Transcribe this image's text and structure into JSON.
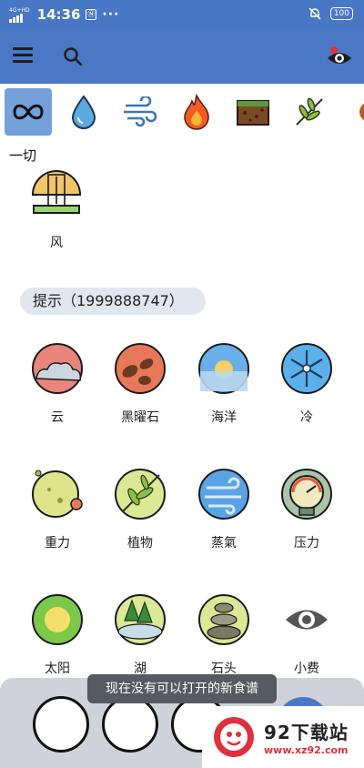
{
  "status_bar": {
    "network": "4G+HD",
    "time": "14:36",
    "hd_badge": "Ⓝ",
    "dots": "···",
    "battery": "100"
  },
  "app_bar": {
    "menu_icon": "hamburger-menu-icon",
    "search_icon": "search-icon",
    "eye_icon": "eye-notification-icon"
  },
  "tabs": [
    {
      "icon": "infinity-icon",
      "active": true
    },
    {
      "icon": "water-drop-icon",
      "active": false
    },
    {
      "icon": "wind-icon",
      "active": false
    },
    {
      "icon": "fire-icon",
      "active": false
    },
    {
      "icon": "earth-icon",
      "active": false
    },
    {
      "icon": "plant-icon",
      "active": false
    },
    {
      "icon": "brown-blob-icon",
      "active": false
    }
  ],
  "filter_label": "一切",
  "top_item": {
    "label": "风",
    "icon": "windmill-icon"
  },
  "hint": "提示（1999888747）",
  "items": [
    {
      "label": "云",
      "icon": "cloud-icon"
    },
    {
      "label": "黑曜石",
      "icon": "obsidian-icon"
    },
    {
      "label": "海洋",
      "icon": "ocean-icon"
    },
    {
      "label": "冷",
      "icon": "snowflake-icon"
    },
    {
      "label": "重力",
      "icon": "gravity-icon"
    },
    {
      "label": "植物",
      "icon": "plant-leaf-icon"
    },
    {
      "label": "蒸氣",
      "icon": "steam-icon"
    },
    {
      "label": "压力",
      "icon": "pressure-gauge-icon"
    },
    {
      "label": "太阳",
      "icon": "sun-icon"
    },
    {
      "label": "湖",
      "icon": "lake-icon"
    },
    {
      "label": "石头",
      "icon": "stone-icon"
    },
    {
      "label": "小费",
      "icon": "eye-tip-icon"
    }
  ],
  "toast": "现在没有可以打开的新食谱",
  "watermark": {
    "title": "92下载站",
    "url": "www.xz92.com"
  },
  "colors": {
    "primary": "#4a78c5",
    "tab_active": "#74a0dc",
    "hint_bg": "#e2e6ee"
  }
}
